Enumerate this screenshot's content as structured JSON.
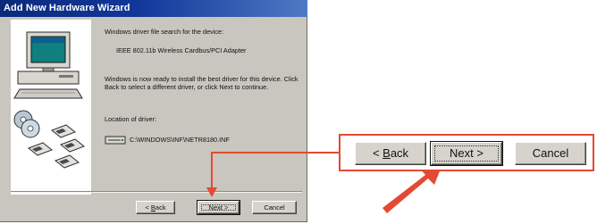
{
  "dialog": {
    "title": "Add New Hardware Wizard",
    "search_heading": "Windows driver file search for the device:",
    "device_name": "IEEE 802.11b Wireless Cardbus/PCI Adapter",
    "ready_text": "Windows is now ready to install the best driver for this device. Click Back to select a different driver, or click Next to continue.",
    "location_label": "Location of driver:",
    "driver_path": "C:\\WINDOWS\\INF\\NETR8180.INF",
    "buttons": {
      "back_mnemonic": "B",
      "back_rest": "ack",
      "back_prefix": "< ",
      "next": "Next >",
      "cancel": "Cancel"
    }
  },
  "callout": {
    "back_prefix": "< ",
    "back_mnemonic": "B",
    "back_rest": "ack",
    "next": "Next >",
    "cancel": "Cancel"
  },
  "colors": {
    "annotation": "#e34a33",
    "title_bar": "#12379a",
    "dialog_face": "#c9c6bf"
  },
  "icons": [
    "computer-icon",
    "cd-disc-icon",
    "floppy-disk-icon",
    "drive-icon",
    "arrow-icon"
  ]
}
